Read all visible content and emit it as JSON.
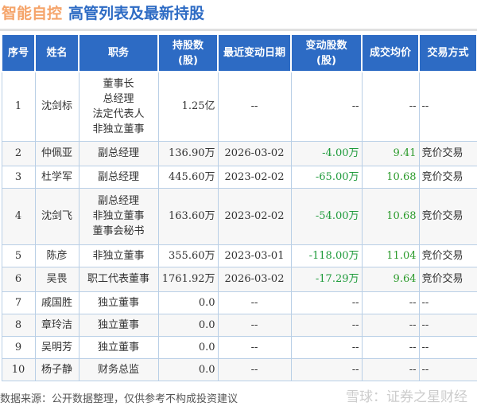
{
  "header": {
    "company": "智能自控",
    "title": "高管列表及最新持股"
  },
  "table": {
    "columns": [
      "序号",
      "姓名",
      "职务",
      "持股数\n(股)",
      "最近变动日期",
      "变动股数\n(股)",
      "成交均价",
      "交易方式"
    ],
    "rows": [
      {
        "no": "1",
        "name": "沈剑标",
        "roles": [
          "董事长",
          "总经理",
          "法定代表人",
          "非独立董事"
        ],
        "shares": "1.25亿",
        "date": "--",
        "change": "--",
        "price": "--",
        "method": "--"
      },
      {
        "no": "2",
        "name": "仲佩亚",
        "roles": [
          "副总经理"
        ],
        "shares": "136.90万",
        "date": "2026-03-02",
        "change": "-4.00万",
        "price": "9.41",
        "method": "竞价交易"
      },
      {
        "no": "3",
        "name": "杜学军",
        "roles": [
          "副总经理"
        ],
        "shares": "445.60万",
        "date": "2023-02-02",
        "change": "-65.00万",
        "price": "10.68",
        "method": "竞价交易"
      },
      {
        "no": "4",
        "name": "沈剑飞",
        "roles": [
          "副总经理",
          "非独立董事",
          "董事会秘书"
        ],
        "shares": "163.60万",
        "date": "2023-02-02",
        "change": "-54.00万",
        "price": "10.68",
        "method": "竞价交易"
      },
      {
        "no": "5",
        "name": "陈彦",
        "roles": [
          "非独立董事"
        ],
        "shares": "355.60万",
        "date": "2023-03-01",
        "change": "-118.00万",
        "price": "11.04",
        "method": "竞价交易"
      },
      {
        "no": "6",
        "name": "吴畏",
        "roles": [
          "职工代表董事"
        ],
        "shares": "1761.92万",
        "date": "2026-03-02",
        "change": "-17.29万",
        "price": "9.64",
        "method": "竞价交易"
      },
      {
        "no": "7",
        "name": "戚国胜",
        "roles": [
          "独立董事"
        ],
        "shares": "0.0",
        "date": "--",
        "change": "--",
        "price": "--",
        "method": "--"
      },
      {
        "no": "8",
        "name": "章玲洁",
        "roles": [
          "独立董事"
        ],
        "shares": "0.0",
        "date": "--",
        "change": "--",
        "price": "--",
        "method": "--"
      },
      {
        "no": "9",
        "name": "吴明芳",
        "roles": [
          "独立董事"
        ],
        "shares": "0.0",
        "date": "--",
        "change": "--",
        "price": "--",
        "method": "--"
      },
      {
        "no": "10",
        "name": "杨子静",
        "roles": [
          "财务总监"
        ],
        "shares": "0.0",
        "date": "--",
        "change": "--",
        "price": "--",
        "method": "--"
      }
    ]
  },
  "footer": {
    "source": "数据来源：公开数据整理，仅供参考不构成投资建议",
    "watermark": "雪球：证券之星财经"
  },
  "colors": {
    "header_bg": "#2d6bc4",
    "company": "#f5a46a",
    "negative": "#1d9a3a"
  }
}
